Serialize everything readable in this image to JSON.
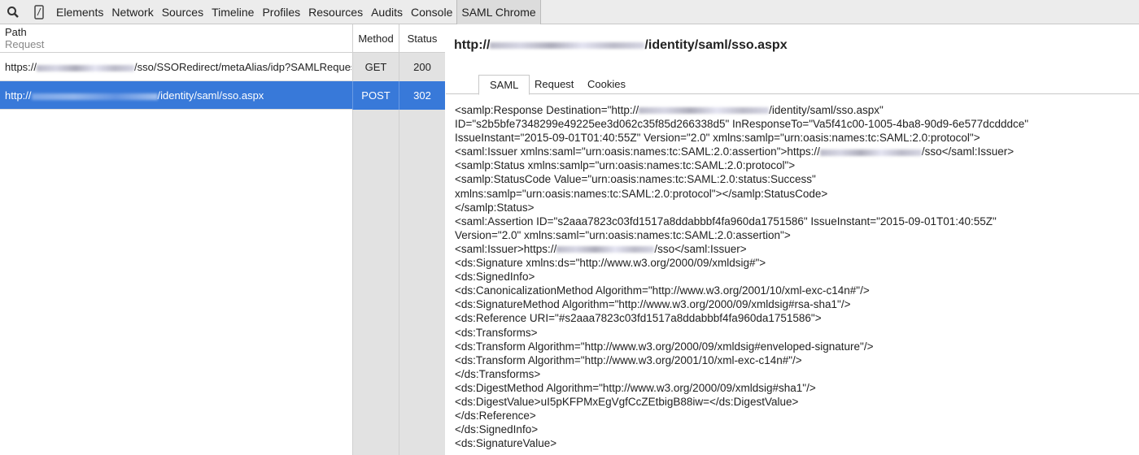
{
  "toolbar": {
    "icons": [
      "search-icon",
      "device-mode-icon"
    ],
    "tabs": [
      "Elements",
      "Network",
      "Sources",
      "Timeline",
      "Profiles",
      "Resources",
      "Audits",
      "Console",
      "SAML Chrome"
    ],
    "active_tab": "SAML Chrome"
  },
  "requests": {
    "headers": {
      "path": "Path",
      "request": "Request",
      "method": "Method",
      "status": "Status"
    },
    "rows": [
      {
        "pre": "https://",
        "post": "/sso/SSORedirect/metaAlias/idp?SAMLRequest",
        "method": "GET",
        "status": "200",
        "selected": false
      },
      {
        "pre": "http://",
        "post": "/identity/saml/sso.aspx",
        "method": "POST",
        "status": "302",
        "selected": true
      }
    ]
  },
  "detail": {
    "url_pre": "http://",
    "url_post": "/identity/saml/sso.aspx",
    "tabs": [
      "SAML",
      "Request",
      "Cookies"
    ],
    "active_tab": "SAML",
    "lines": [
      {
        "pre": "<samlp:Response Destination=\"http://",
        "post": "/identity/saml/sso.aspx\""
      },
      {
        "pre": "ID=\"s2b5bfe7348299e49225ee3d062c35f85d266338d5\" InResponseTo=\"Va5f41c00-1005-4ba8-90d9-6e577dcdddce\""
      },
      {
        "pre": "IssueInstant=\"2015-09-01T01:40:55Z\" Version=\"2.0\" xmlns:samlp=\"urn:oasis:names:tc:SAML:2.0:protocol\">"
      },
      {
        "pre": "<saml:Issuer xmlns:saml=\"urn:oasis:names:tc:SAML:2.0:assertion\">https://",
        "post": "/sso</saml:Issuer>"
      },
      {
        "pre": "<samlp:Status xmlns:samlp=\"urn:oasis:names:tc:SAML:2.0:protocol\">"
      },
      {
        "pre": "<samlp:StatusCode Value=\"urn:oasis:names:tc:SAML:2.0:status:Success\""
      },
      {
        "pre": "xmlns:samlp=\"urn:oasis:names:tc:SAML:2.0:protocol\"></samlp:StatusCode>"
      },
      {
        "pre": "</samlp:Status>"
      },
      {
        "pre": "<saml:Assertion ID=\"s2aaa7823c03fd1517a8ddabbbf4fa960da1751586\" IssueInstant=\"2015-09-01T01:40:55Z\""
      },
      {
        "pre": "Version=\"2.0\" xmlns:saml=\"urn:oasis:names:tc:SAML:2.0:assertion\">"
      },
      {
        "pre": "<saml:Issuer>https://",
        "post": "/sso</saml:Issuer>"
      },
      {
        "pre": "<ds:Signature xmlns:ds=\"http://www.w3.org/2000/09/xmldsig#\">"
      },
      {
        "pre": "<ds:SignedInfo>"
      },
      {
        "pre": "<ds:CanonicalizationMethod Algorithm=\"http://www.w3.org/2001/10/xml-exc-c14n#\"/>"
      },
      {
        "pre": "<ds:SignatureMethod Algorithm=\"http://www.w3.org/2000/09/xmldsig#rsa-sha1\"/>"
      },
      {
        "pre": "<ds:Reference URI=\"#s2aaa7823c03fd1517a8ddabbbf4fa960da1751586\">"
      },
      {
        "pre": "<ds:Transforms>"
      },
      {
        "pre": "<ds:Transform Algorithm=\"http://www.w3.org/2000/09/xmldsig#enveloped-signature\"/>"
      },
      {
        "pre": "<ds:Transform Algorithm=\"http://www.w3.org/2001/10/xml-exc-c14n#\"/>"
      },
      {
        "pre": "</ds:Transforms>"
      },
      {
        "pre": "<ds:DigestMethod Algorithm=\"http://www.w3.org/2000/09/xmldsig#sha1\"/>"
      },
      {
        "pre": "<ds:DigestValue>uI5pKFPMxEgVgfCcZEtbigB88iw=</ds:DigestValue>"
      },
      {
        "pre": "</ds:Reference>"
      },
      {
        "pre": "</ds:SignedInfo>"
      },
      {
        "pre": "<ds:SignatureValue>"
      }
    ]
  },
  "colors": {
    "selected": "#3879d9",
    "column_bg": "#e2e2e2",
    "toolbar_bg": "#ececec"
  }
}
